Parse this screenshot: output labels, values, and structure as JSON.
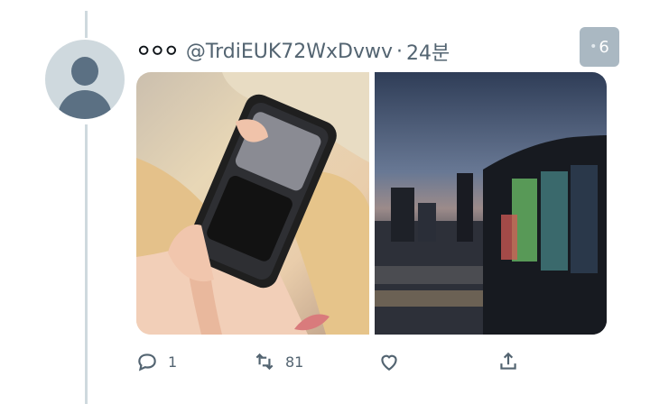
{
  "tweet": {
    "display_name": "০০০",
    "handle": "@TrdiEUK72WxDvwv",
    "separator": "·",
    "time": "24분",
    "media_count": "6"
  },
  "actions": {
    "reply_count": "1",
    "retweet_count": "81"
  },
  "icons": [
    "reply-icon",
    "retweet-icon",
    "like-icon",
    "share-icon"
  ],
  "colors": {
    "secondary_text": "#536471",
    "thread_line": "#cfd9de"
  }
}
